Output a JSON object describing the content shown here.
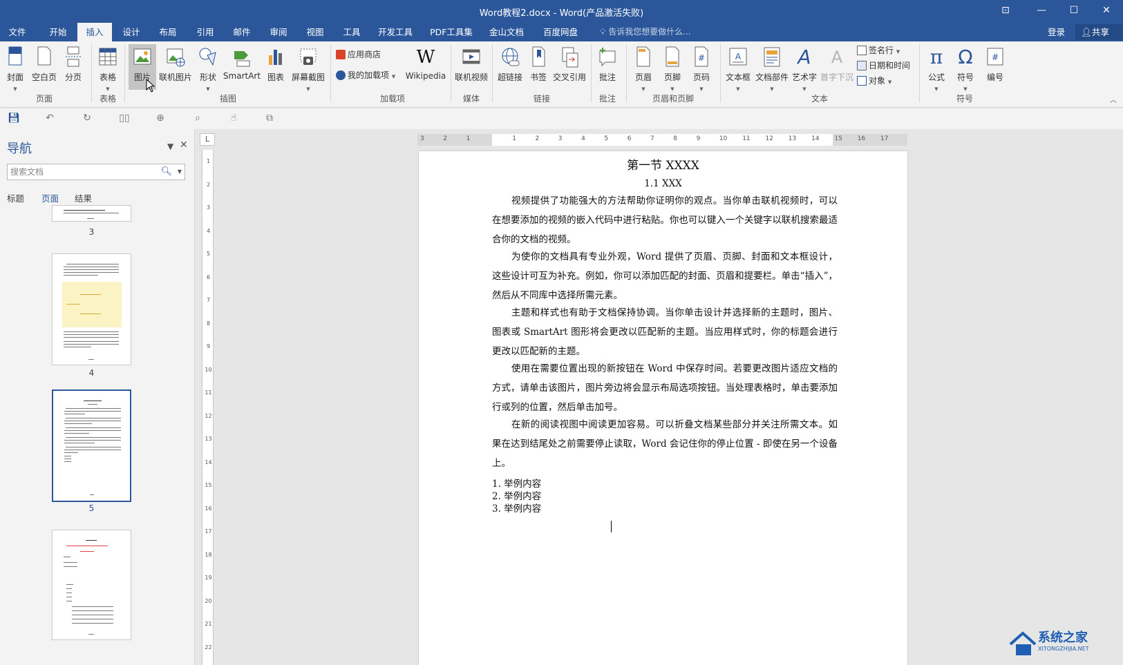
{
  "window": {
    "title": "Word教程2.docx - Word(产品激活失败)",
    "controls": [
      "⊡",
      "—",
      "☐",
      "✕"
    ]
  },
  "menu": {
    "tabs": [
      "文件",
      "开始",
      "插入",
      "设计",
      "布局",
      "引用",
      "邮件",
      "审阅",
      "视图",
      "工具",
      "开发工具",
      "PDF工具集",
      "金山文档",
      "百度网盘"
    ],
    "active_tab": "插入",
    "tell_me": "告诉我您想要做什么...",
    "login": "登录",
    "share": "共享"
  },
  "ribbon": {
    "pages": {
      "cover": "封面",
      "blank": "空白页",
      "break": "分页",
      "group": "页面"
    },
    "tables": {
      "table": "表格",
      "group": "表格"
    },
    "illustrations": {
      "picture": "图片",
      "online_picture": "联机图片",
      "shapes": "形状",
      "smartart": "SmartArt",
      "chart": "图表",
      "screenshot": "屏幕截图",
      "group": "插图"
    },
    "addins": {
      "store": "应用商店",
      "my_addins": "我的加载项",
      "wikipedia": "Wikipedia",
      "group": "加载项"
    },
    "media": {
      "online_video": "联机视频",
      "group": "媒体"
    },
    "links": {
      "hyperlink": "超链接",
      "bookmark": "书签",
      "cross_ref": "交叉引用",
      "group": "链接"
    },
    "comments": {
      "comment": "批注",
      "group": "批注"
    },
    "header_footer": {
      "header": "页眉",
      "footer": "页脚",
      "page_number": "页码",
      "group": "页眉和页脚"
    },
    "text": {
      "textbox": "文本框",
      "quick_parts": "文档部件",
      "wordart": "艺术字",
      "dropcap": "首字下沉",
      "signature": "签名行",
      "datetime": "日期和时间",
      "object": "对象",
      "group": "文本"
    },
    "symbols": {
      "equation": "公式",
      "symbol": "符号",
      "number": "编号",
      "group": "符号"
    }
  },
  "nav": {
    "title": "导航",
    "search_placeholder": "搜索文档",
    "tabs": [
      "标题",
      "页面",
      "结果"
    ],
    "active_tab": "页面",
    "pages": [
      "3",
      "4",
      "5"
    ],
    "selected_page": "5"
  },
  "ruler": {
    "h_ticks": [
      "3",
      "2",
      "1",
      "1",
      "2",
      "3",
      "4",
      "5",
      "6",
      "7",
      "8",
      "9",
      "10",
      "11",
      "12",
      "13",
      "14",
      "15",
      "16",
      "17"
    ],
    "v_ticks": [
      "1",
      "2",
      "3",
      "4",
      "5",
      "6",
      "7",
      "8",
      "9",
      "10",
      "11",
      "12",
      "13",
      "14",
      "15",
      "16",
      "17",
      "18",
      "19",
      "20",
      "21",
      "22"
    ],
    "corner": "L"
  },
  "document": {
    "heading1": "第一节 XXXX",
    "heading2": "1.1 XXX",
    "paragraphs": [
      "视频提供了功能强大的方法帮助你证明你的观点。当你单击联机视频时，可以在想要添加的视频的嵌入代码中进行粘贴。你也可以键入一个关键字以联机搜索最适合你的文档的视频。",
      "为使你的文档具有专业外观，Word 提供了页眉、页脚、封面和文本框设计，这些设计可互为补充。例如，你可以添加匹配的封面、页眉和提要栏。单击“插入”，然后从不同库中选择所需元素。",
      "主题和样式也有助于文档保持协调。当你单击设计并选择新的主题时，图片、图表或 SmartArt 图形将会更改以匹配新的主题。当应用样式时，你的标题会进行更改以匹配新的主题。",
      "使用在需要位置出现的新按钮在 Word 中保存时间。若要更改图片适应文档的方式，请单击该图片，图片旁边将会显示布局选项按钮。当处理表格时，单击要添加行或列的位置，然后单击加号。",
      "在新的阅读视图中阅读更加容易。可以折叠文档某些部分并关注所需文本。如果在达到结尾处之前需要停止读取，Word 会记住你的停止位置 - 即使在另一个设备上。"
    ],
    "list": [
      "1. 举例内容",
      "2. 举例内容",
      "3. 举例内容"
    ]
  },
  "watermark": {
    "title": "系统之家",
    "subtitle": "XITONGZHIJIA.NET"
  },
  "colors": {
    "brand": "#2b579a",
    "ribbon_bg": "#f3f3f3"
  }
}
